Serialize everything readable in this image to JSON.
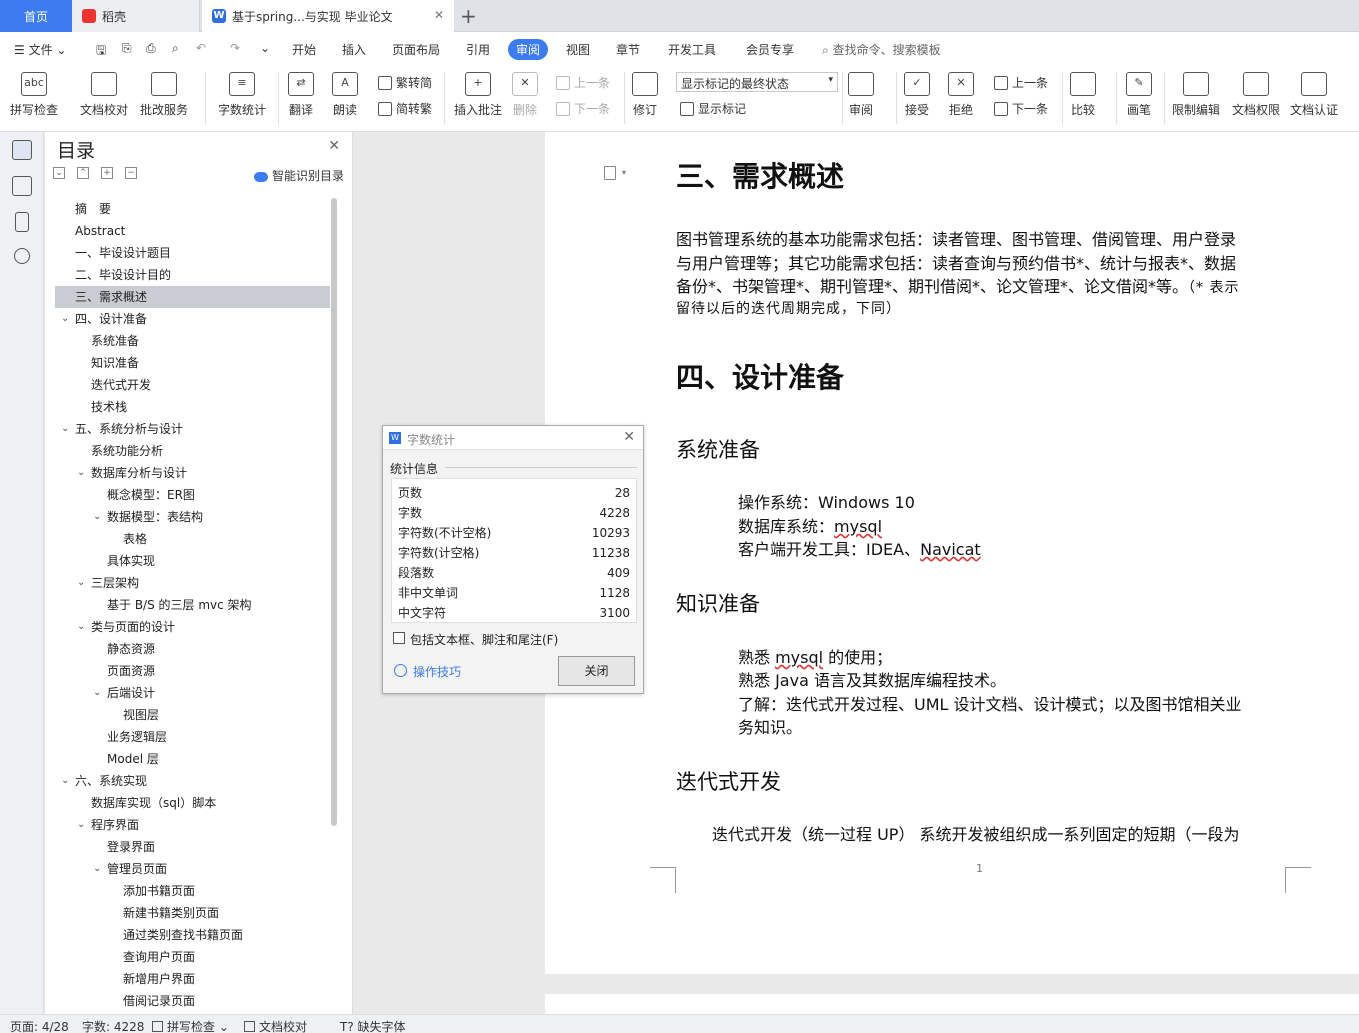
{
  "tabs": {
    "home": "首页",
    "daoke": "稻壳",
    "doc": "基于spring...与实现 毕业论文"
  },
  "menu": {
    "file": "文件",
    "items": [
      "开始",
      "插入",
      "页面布局",
      "引用",
      "审阅",
      "视图",
      "章节",
      "开发工具",
      "会员专享"
    ],
    "search": "查找命令、搜索模板"
  },
  "ribbon": {
    "spellcheck": "拼写检查",
    "proofread": "文档校对",
    "revise_service": "批改服务",
    "word_count": "字数统计",
    "translate": "翻译",
    "read_aloud": "朗读",
    "to_traditional": "繁转简",
    "to_simplified": "简转繁",
    "insert_comment": "插入批注",
    "delete": "删除",
    "prev": "上一条",
    "next": "下一条",
    "track": "修订",
    "markup_state": "显示标记的最终状态",
    "show_markup": "显示标记",
    "review": "审阅",
    "accept": "接受",
    "reject": "拒绝",
    "prev2": "上一条",
    "next2": "下一条",
    "compare": "比较",
    "pen": "画笔",
    "restrict": "限制编辑",
    "permission": "文档权限",
    "certify": "文档认证"
  },
  "toc": {
    "title": "目录",
    "smart": "智能识别目录",
    "items": [
      {
        "label": "摘　要",
        "level": 1
      },
      {
        "label": "Abstract",
        "level": 1
      },
      {
        "label": "一、毕设设计题目",
        "level": 1
      },
      {
        "label": "二、毕设设计目的",
        "level": 1
      },
      {
        "label": "三、需求概述",
        "level": 1,
        "selected": true
      },
      {
        "label": "四、设计准备",
        "level": 1,
        "expanded": true
      },
      {
        "label": "系统准备",
        "level": 2
      },
      {
        "label": "知识准备",
        "level": 2
      },
      {
        "label": "迭代式开发",
        "level": 2
      },
      {
        "label": "技术栈",
        "level": 2
      },
      {
        "label": "五、系统分析与设计",
        "level": 1,
        "expanded": true
      },
      {
        "label": "系统功能分析",
        "level": 2
      },
      {
        "label": "数据库分析与设计",
        "level": 2,
        "expanded": true
      },
      {
        "label": "概念模型：ER图",
        "level": 3
      },
      {
        "label": "数据模型：表结构",
        "level": 3,
        "expanded": true
      },
      {
        "label": "表格",
        "level": 4
      },
      {
        "label": "具体实现",
        "level": 3
      },
      {
        "label": "三层架构",
        "level": 2,
        "expanded": true
      },
      {
        "label": "基于 B/S 的三层 mvc 架构",
        "level": 3
      },
      {
        "label": "类与页面的设计",
        "level": 2,
        "expanded": true
      },
      {
        "label": "静态资源",
        "level": 3
      },
      {
        "label": "页面资源",
        "level": 3
      },
      {
        "label": "后端设计",
        "level": 3,
        "expanded": true
      },
      {
        "label": "视图层",
        "level": 4
      },
      {
        "label": "业务逻辑层",
        "level": 3
      },
      {
        "label": "Model 层",
        "level": 3
      },
      {
        "label": "六、系统实现",
        "level": 1,
        "expanded": true
      },
      {
        "label": "数据库实现（sql）脚本",
        "level": 2
      },
      {
        "label": "程序界面",
        "level": 2,
        "expanded": true
      },
      {
        "label": "登录界面",
        "level": 3
      },
      {
        "label": "管理员页面",
        "level": 3,
        "expanded": true
      },
      {
        "label": "添加书籍页面",
        "level": 4
      },
      {
        "label": "新建书籍类别页面",
        "level": 4
      },
      {
        "label": "通过类别查找书籍页面",
        "level": 4
      },
      {
        "label": "查询用户页面",
        "level": 4
      },
      {
        "label": "新增用户界面",
        "level": 4
      },
      {
        "label": "借阅记录页面",
        "level": 4
      }
    ]
  },
  "doc": {
    "h_req": "三、需求概述",
    "req_l1": "图书管理系统的基本功能需求包括：读者管理、图书管理、借阅管理、用户登录",
    "req_l2": "与用户管理等；其它功能需求包括：读者查询与预约借书*、统计与报表*、数据",
    "req_l3": "备份*、书架管理*、期刊管理*、期刊借阅*、论文管理*、论文借阅*等。",
    "req_note_a": "（* 表示",
    "req_note_b": "留待以后的迭代周期完成，下同）",
    "h_prep": "四、设计准备",
    "h_sys": "系统准备",
    "sys_os": "操作系统：Windows 10",
    "sys_db_a": "数据库系统：",
    "sys_db_b": "mysql",
    "sys_tool_a": "客户端开发工具：IDEA、",
    "sys_tool_b": "Navicat",
    "h_know": "知识准备",
    "know_1a": "熟悉 ",
    "know_1b": "mysql",
    "know_1c": " 的使用；",
    "know_2": "熟悉 Java 语言及其数据库编程技术。",
    "know_3a": "了解：迭代式开发过程、UML 设计文档、设计模式；以及图书馆相关业",
    "know_3b": "务知识。",
    "h_iter": "迭代式开发",
    "iter_1": "迭代式开发（统一过程 UP） 系统开发被组织成一系列固定的短期（一段为",
    "page_number": "1"
  },
  "dialog": {
    "title": "字数统计",
    "section": "统计信息",
    "rows": [
      {
        "label": "页数",
        "value": "28"
      },
      {
        "label": "字数",
        "value": "4228"
      },
      {
        "label": "字符数(不计空格)",
        "value": "10293"
      },
      {
        "label": "字符数(计空格)",
        "value": "11238"
      },
      {
        "label": "段落数",
        "value": "409"
      },
      {
        "label": "非中文单词",
        "value": "1128"
      },
      {
        "label": "中文字符",
        "value": "3100"
      }
    ],
    "include_label": "包括文本框、脚注和尾注(F)",
    "tips": "操作技巧",
    "close": "关闭"
  },
  "status": {
    "page": "页面: 4/28",
    "words": "字数: 4228",
    "spell": "拼写检查",
    "proof": "文档校对",
    "missing_font": "缺失字体"
  },
  "colors": {
    "accent": "#3c7bf0",
    "spell_error": "#dd3333"
  }
}
